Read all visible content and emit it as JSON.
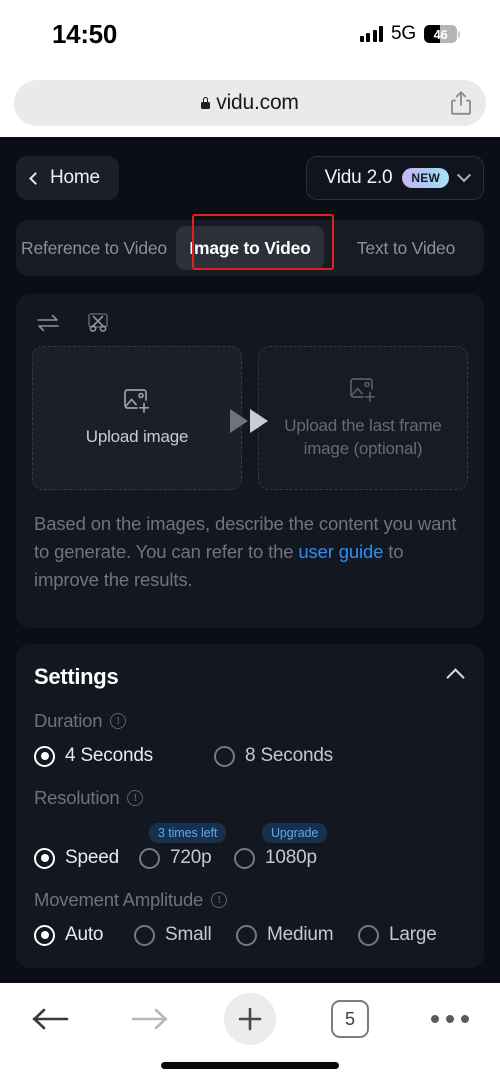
{
  "status_bar": {
    "time": "14:50",
    "network": "5G",
    "battery_level": "46",
    "signal_icon": "cellular-bars-icon",
    "battery_icon": "battery-icon"
  },
  "browser": {
    "url": "vidu.com",
    "lock_icon": "lock-icon",
    "share_icon": "share-icon",
    "bottom_bar": {
      "back_icon": "back-arrow-icon",
      "forward_icon": "forward-arrow-icon",
      "new_tab_icon": "plus-icon",
      "tab_count": "5",
      "more_icon": "more-dots-icon"
    }
  },
  "app": {
    "header": {
      "home_label": "Home",
      "back_chevron_icon": "chevron-left-icon",
      "model_name": "Vidu 2.0",
      "model_badge": "NEW",
      "model_chevron_icon": "chevron-down-icon"
    },
    "tabs": [
      {
        "label": "Reference to Video",
        "active": false
      },
      {
        "label": "Image to Video",
        "active": true
      },
      {
        "label": "Text to Video",
        "active": false
      }
    ],
    "annotation": {
      "target": "Image to Video",
      "color": "#e02020"
    },
    "upload_panel": {
      "swap_icon": "swap-arrows-icon",
      "crop_icon": "scissors-crop-icon",
      "transition_icon": "fast-forward-icon",
      "first_frame": {
        "label": "Upload image",
        "icon": "image-add-icon"
      },
      "last_frame": {
        "label": "Upload the last frame image (optional)",
        "icon": "image-add-icon"
      }
    },
    "prompt": {
      "text_before_link": "Based on the images, describe the content you want to generate. You can refer to the ",
      "link_text": "user guide",
      "text_after_link": " to improve the results."
    },
    "settings": {
      "title": "Settings",
      "collapse_icon": "chevron-up-icon",
      "info_icon": "info-icon",
      "info_glyph": "!",
      "groups": [
        {
          "label": "Duration",
          "options": [
            {
              "label": "4 Seconds",
              "selected": true,
              "badge": null
            },
            {
              "label": "8 Seconds",
              "selected": false,
              "badge": null
            }
          ]
        },
        {
          "label": "Resolution",
          "options": [
            {
              "label": "Speed",
              "selected": true,
              "badge": null
            },
            {
              "label": "720p",
              "selected": false,
              "badge": "3 times left"
            },
            {
              "label": "1080p",
              "selected": false,
              "badge": "Upgrade"
            }
          ]
        },
        {
          "label": "Movement Amplitude",
          "options": [
            {
              "label": "Auto",
              "selected": true,
              "badge": null
            },
            {
              "label": "Small",
              "selected": false,
              "badge": null
            },
            {
              "label": "Medium",
              "selected": false,
              "badge": null
            },
            {
              "label": "Large",
              "selected": false,
              "badge": null
            }
          ]
        }
      ]
    }
  },
  "colors": {
    "app_background": "#0b0e14",
    "card_background": "#131720",
    "accent_link": "#2f8ef4",
    "annotation_red": "#e02020",
    "badge_text": "#5aa9f0",
    "badge_background": "#16304d"
  }
}
